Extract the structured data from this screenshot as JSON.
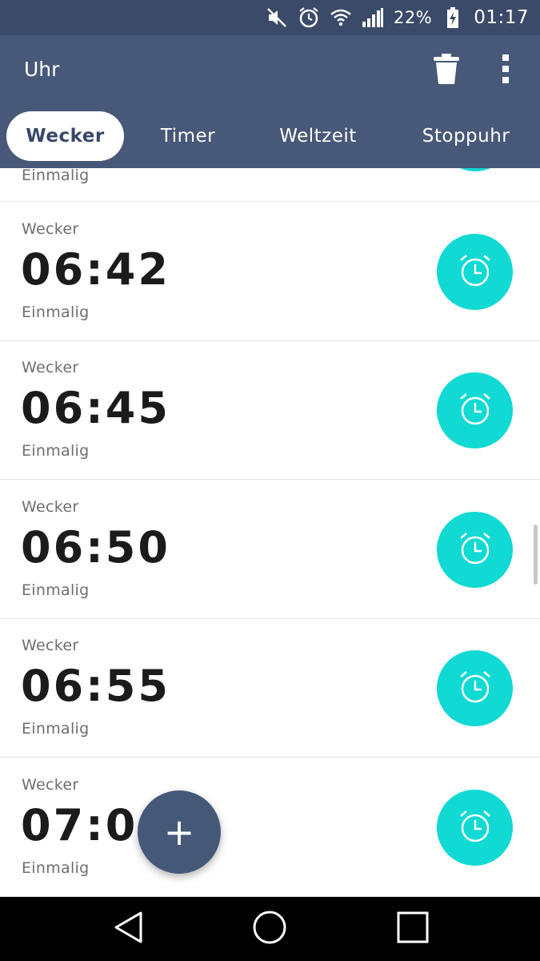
{
  "status_bar": {
    "battery": "22%",
    "time": "01:17",
    "icons": [
      "mute-icon",
      "alarm-icon",
      "wifi-icon",
      "signal-icon",
      "battery-charging-icon"
    ]
  },
  "app_bar": {
    "title": "Uhr",
    "actions": [
      "trash-icon",
      "more-vert-icon"
    ]
  },
  "tabs": [
    {
      "label": "Wecker",
      "active": true
    },
    {
      "label": "Timer",
      "active": false
    },
    {
      "label": "Weltzeit",
      "active": false
    },
    {
      "label": "Stoppuhr",
      "active": false
    }
  ],
  "partial_alarm": {
    "repeat": "Einmalig"
  },
  "alarms": [
    {
      "label": "Wecker",
      "time": "06:42",
      "repeat": "Einmalig"
    },
    {
      "label": "Wecker",
      "time": "06:45",
      "repeat": "Einmalig"
    },
    {
      "label": "Wecker",
      "time": "06:50",
      "repeat": "Einmalig"
    },
    {
      "label": "Wecker",
      "time": "06:55",
      "repeat": "Einmalig"
    },
    {
      "label": "Wecker",
      "time": "07:00",
      "repeat": "Einmalig"
    }
  ],
  "fab": {
    "label": "+"
  },
  "colors": {
    "status_bar": "#3a4a68",
    "app_bar": "#475878",
    "alarm_button": "#11d9d3",
    "fab": "#465878"
  }
}
